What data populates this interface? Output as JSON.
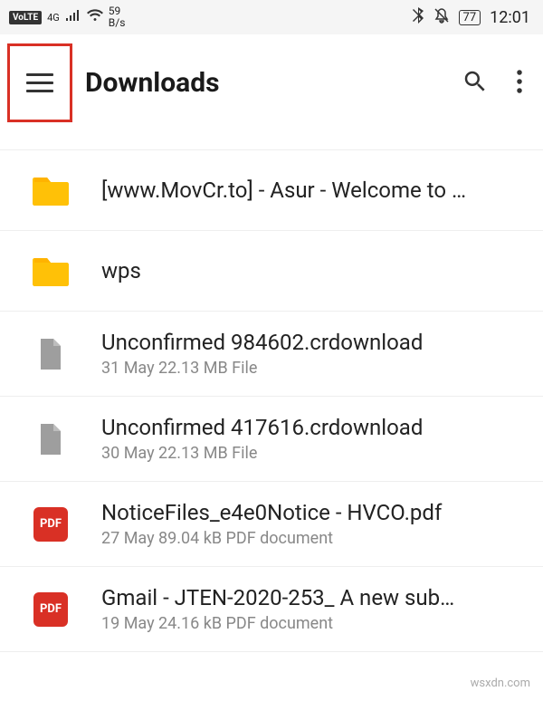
{
  "status": {
    "volte": "VoLTE",
    "net": "4G",
    "speed_value": "59",
    "speed_unit": "B/s",
    "battery": "77",
    "time": "12:01"
  },
  "header": {
    "title": "Downloads"
  },
  "files": [
    {
      "type": "folder",
      "name": "[www.MovCr.to] - Asur - Welcome to …",
      "meta": ""
    },
    {
      "type": "folder",
      "name": "wps",
      "meta": ""
    },
    {
      "type": "file",
      "name": "Unconfirmed 984602.crdownload",
      "meta": "31 May 22.13 MB File"
    },
    {
      "type": "file",
      "name": "Unconfirmed 417616.crdownload",
      "meta": "30 May 22.13 MB File"
    },
    {
      "type": "pdf",
      "name": "NoticeFiles_e4e0Notice - HVCO.pdf",
      "meta": "27 May 89.04 kB PDF document"
    },
    {
      "type": "pdf",
      "name": "Gmail - JTEN-2020-253_ A new sub…",
      "meta": "19 May 24.16 kB PDF document"
    }
  ],
  "pdf_label": "PDF",
  "watermark": "wsxdn.com"
}
